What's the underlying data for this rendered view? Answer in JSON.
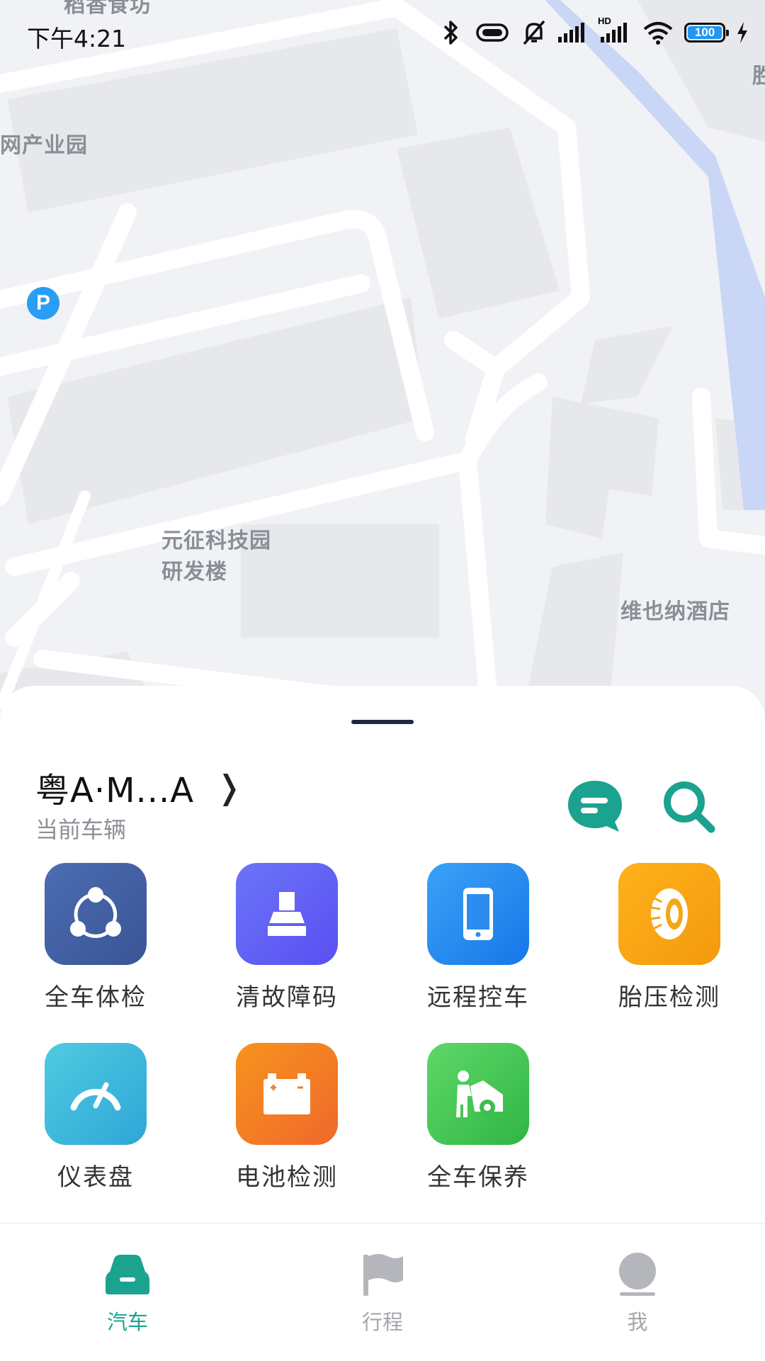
{
  "status_bar": {
    "time": "下午4:21",
    "battery_level": "100",
    "network_badge": "HD"
  },
  "map": {
    "labels": [
      "稻香食坊",
      "网产业园",
      "元征科技园",
      "研发楼",
      "维也纳酒店",
      "胜"
    ],
    "parking_symbol": "P"
  },
  "vehicle": {
    "plate": "粤A·M...A",
    "subtitle": "当前车辆"
  },
  "features": [
    {
      "label": "全车体检",
      "icon": "vehicle-inspection-icon"
    },
    {
      "label": "清故障码",
      "icon": "clear-fault-code-icon"
    },
    {
      "label": "远程控车",
      "icon": "remote-control-phone-icon"
    },
    {
      "label": "胎压检测",
      "icon": "tire-pressure-icon"
    },
    {
      "label": "仪表盘",
      "icon": "dashboard-gauge-icon"
    },
    {
      "label": "电池检测",
      "icon": "battery-test-icon"
    },
    {
      "label": "全车保养",
      "icon": "car-maintenance-icon"
    }
  ],
  "tabs": [
    {
      "label": "汽车",
      "icon": "car-icon",
      "active": true
    },
    {
      "label": "行程",
      "icon": "flag-icon",
      "active": false
    },
    {
      "label": "我",
      "icon": "profile-icon",
      "active": false
    }
  ],
  "colors": {
    "accent": "#1ba38f",
    "inactive_tab": "#a4a6ab"
  }
}
